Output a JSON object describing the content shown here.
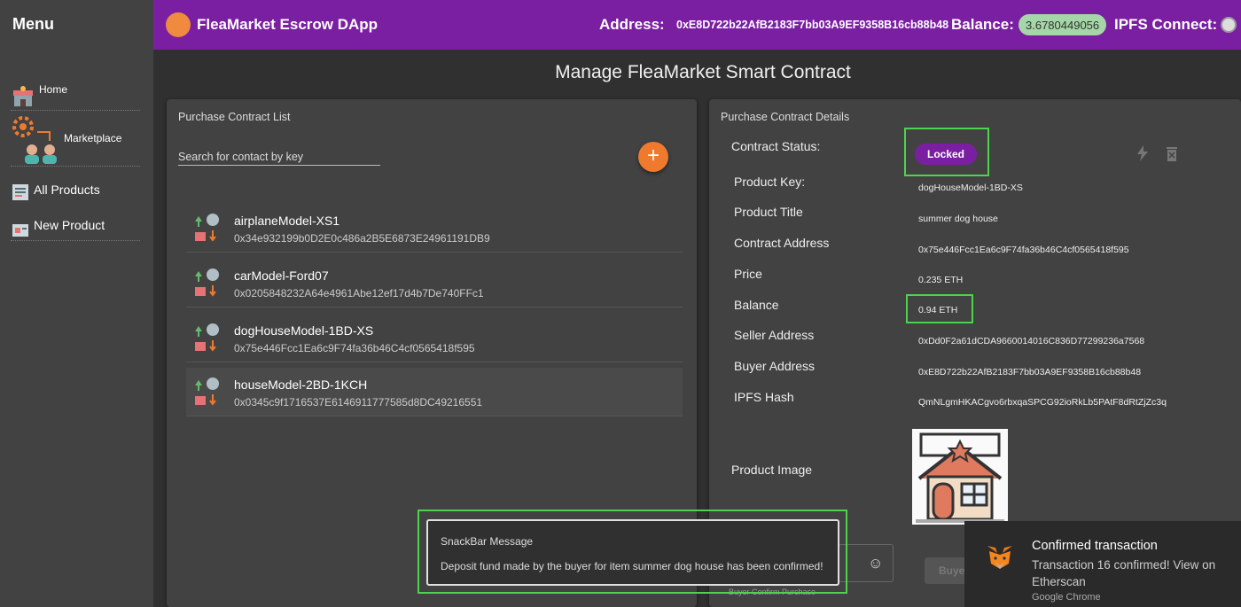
{
  "sidebar": {
    "title": "Menu",
    "items": [
      {
        "label": "Home",
        "icon": "shop-icon"
      },
      {
        "label": "Marketplace",
        "icon": "gear-people-icon"
      },
      {
        "label": "All Products",
        "icon": "list-icon"
      },
      {
        "label": "New Product",
        "icon": "product-icon"
      }
    ]
  },
  "header": {
    "title": "FleaMarket Escrow DApp",
    "address_label": "Address:",
    "address_value": "0xE8D722b22AfB2183F7bb03A9EF9358B16cb88b48",
    "balance_label": "Balance:",
    "balance_value": "3.6780449056",
    "ipfs_label": "IPFS Connect:"
  },
  "page_title": "Manage FleaMarket Smart Contract",
  "list_panel": {
    "caption": "Purchase Contract List",
    "search_placeholder": "Search for contact by key",
    "add_label": "+",
    "contracts": [
      {
        "key": "airplaneModel-XS1",
        "address": "0x34e932199b0D2E0c486a2B5E6873E24961191DB9"
      },
      {
        "key": "carModel-Ford07",
        "address": "0x0205848232A64e4961Abe12ef17d4b7De740FFc1"
      },
      {
        "key": "dogHouseModel-1BD-XS",
        "address": "0x75e446Fcc1Ea6c9F74fa36b46C4cf0565418f595"
      },
      {
        "key": "houseModel-2BD-1KCH",
        "address": "0x0345c9f1716537E6146911777585d8DC49216551"
      }
    ]
  },
  "details_panel": {
    "caption": "Purchase Contract Details",
    "status_label": "Contract Status:",
    "status_value": "Locked",
    "fields": [
      {
        "label": "Product Key:",
        "value": "dogHouseModel-1BD-XS"
      },
      {
        "label": "Product Title",
        "value": "summer dog house"
      },
      {
        "label": "Contract Address",
        "value": "0x75e446Fcc1Ea6c9F74fa36b46C4cf0565418f595"
      },
      {
        "label": "Price",
        "value": "0.235 ETH"
      },
      {
        "label": "Balance",
        "value": "0.94 ETH"
      },
      {
        "label": "Seller Address",
        "value": "0xDd0F2a61dCDA9660014016C836D77299236a7568"
      },
      {
        "label": "Buyer Address",
        "value": "0xE8D722b22AfB2183F7bb03A9EF9358B16cb88b48"
      },
      {
        "label": "IPFS Hash",
        "value": "QmNLgmHKACgvo6rbxqaSPCG92ioRkLb5PAtF8dRtZjZc3q"
      }
    ],
    "image_label": "Product Image",
    "buyer_button": "Buyer",
    "buyer_confirm_caption": "Buyer Confirm Purchase"
  },
  "snackbar": {
    "title": "SnackBar Message",
    "message": "Deposit fund made by the buyer for item summer dog house has been confirmed!"
  },
  "notification": {
    "title": "Confirmed transaction",
    "body": "Transaction 16 confirmed! View on Etherscan",
    "source": "Google Chrome"
  },
  "colors": {
    "topbar": "#7b1fa2",
    "accent_orange": "#ef7a2e",
    "balance_pill": "#a5d6a7",
    "highlight": "#4dd34d"
  }
}
